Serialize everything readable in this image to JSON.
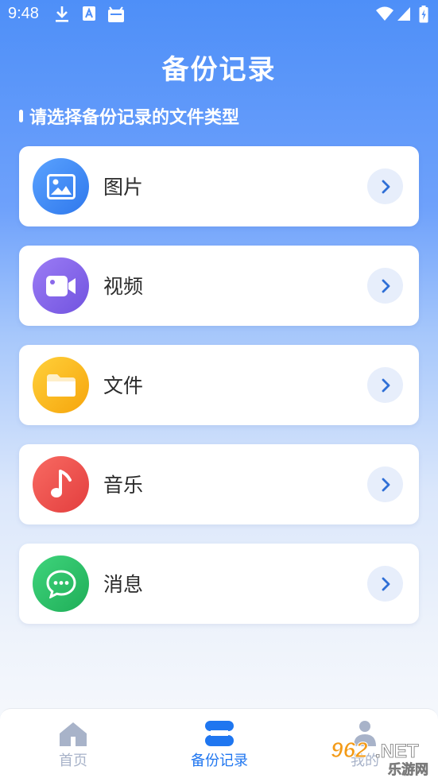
{
  "status_bar": {
    "time": "9:48"
  },
  "header": {
    "title": "备份记录"
  },
  "section": {
    "label": "请选择备份记录的文件类型"
  },
  "categories": [
    {
      "label": "图片",
      "icon": "image-icon",
      "color": "#3a86f0"
    },
    {
      "label": "视频",
      "icon": "video-camera-icon",
      "color": "#8a68ea"
    },
    {
      "label": "文件",
      "icon": "folder-icon",
      "color": "#f9b515"
    },
    {
      "label": "音乐",
      "icon": "music-note-icon",
      "color": "#ef5350"
    },
    {
      "label": "消息",
      "icon": "chat-bubble-icon",
      "color": "#2ec26a"
    }
  ],
  "bottom_nav": {
    "items": [
      {
        "label": "首页",
        "icon": "home-icon",
        "active": false
      },
      {
        "label": "备份记录",
        "icon": "backup-records-icon",
        "active": true
      },
      {
        "label": "我的",
        "icon": "profile-icon",
        "active": false
      }
    ]
  },
  "watermark": {
    "text": "962.NET",
    "subtext": "乐游网"
  },
  "colors": {
    "accent": "#1f76f0",
    "inactive": "#a8b3c9",
    "arrow_bg": "#e7eefb",
    "arrow": "#2f6fd6"
  }
}
